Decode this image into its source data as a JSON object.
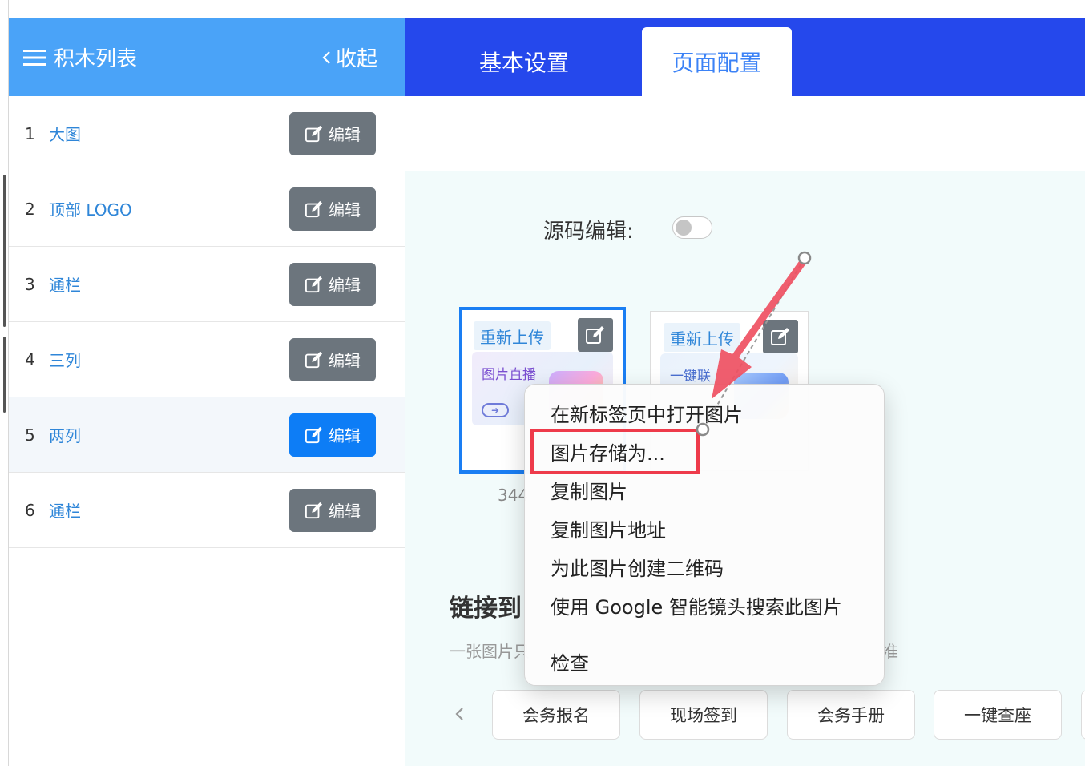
{
  "sidebar": {
    "title": "积木列表",
    "collapse_label": "收起",
    "items": [
      {
        "num": "1",
        "name": "大图",
        "edit": "编辑",
        "active": false
      },
      {
        "num": "2",
        "name": "顶部 LOGO",
        "edit": "编辑",
        "active": false
      },
      {
        "num": "3",
        "name": "通栏",
        "edit": "编辑",
        "active": false
      },
      {
        "num": "4",
        "name": "三列",
        "edit": "编辑",
        "active": false
      },
      {
        "num": "5",
        "name": "两列",
        "edit": "编辑",
        "active": true
      },
      {
        "num": "6",
        "name": "通栏",
        "edit": "编辑",
        "active": false
      }
    ]
  },
  "tabs": [
    {
      "label": "基本设置",
      "active": false
    },
    {
      "label": "页面配置",
      "active": true
    }
  ],
  "source_edit": {
    "label": "源码编辑:",
    "enabled": false
  },
  "cards": [
    {
      "reupload": "重新上传",
      "caption": "图片直播",
      "selected": true
    },
    {
      "reupload": "重新上传",
      "caption": "一键联",
      "selected": false
    }
  ],
  "card_size_text": "344",
  "link_section": {
    "title": "链接到",
    "desc": "一张图片只",
    "desc_tail": "准"
  },
  "link_pills": [
    "会务报名",
    "现场签到",
    "会务手册",
    "一键查座"
  ],
  "context_menu": {
    "items": [
      "在新标签页中打开图片",
      "图片存储为...",
      "复制图片",
      "复制图片地址",
      "为此图片创建二维码",
      "使用 Google 智能镜头搜索此图片"
    ],
    "footer_item": "检查",
    "highlighted_index": 1
  },
  "colors": {
    "sidebar_header": "#4aa3f8",
    "tabbar": "#2548ec",
    "edit_btn": "#6c757d",
    "edit_btn_active": "#0d7df6",
    "link_text": "#2f86d8",
    "annotation_red": "#ee3b4b"
  },
  "icons": {
    "menu": "hamburger-icon",
    "collapse": "chevron-left-icon",
    "edit": "edit-square-icon",
    "pager_prev": "chevron-left-icon"
  }
}
